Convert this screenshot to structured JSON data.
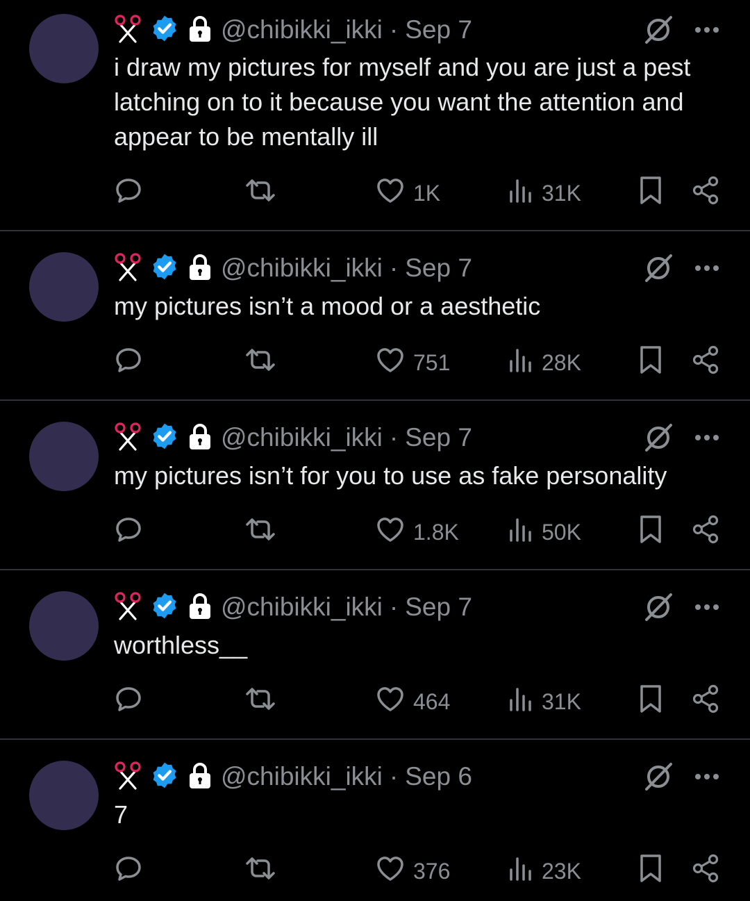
{
  "colors": {
    "background": "#000000",
    "text": "#e7e9ea",
    "muted": "#8b8f94",
    "divider": "#2f3336",
    "verified": "#1d9bf0",
    "avatar": "#332e4f"
  },
  "icons": [
    "scissors-icon",
    "verified-badge-icon",
    "lock-icon",
    "grok-icon",
    "more-icon",
    "reply-icon",
    "retweet-icon",
    "like-icon",
    "views-icon",
    "bookmark-icon",
    "share-icon"
  ],
  "tweets": [
    {
      "handle": "@chibikki_ikki",
      "separator": "·",
      "date": "Sep 7",
      "text": "i draw my pictures for myself and you are just a pest latching on to it because you want the attention and appear to be mentally ill",
      "likes": "1K",
      "views": "31K"
    },
    {
      "handle": "@chibikki_ikki",
      "separator": "·",
      "date": "Sep 7",
      "text": "my pictures isn’t a mood or a aesthetic",
      "likes": "751",
      "views": "28K"
    },
    {
      "handle": "@chibikki_ikki",
      "separator": "·",
      "date": "Sep 7",
      "text": "my pictures isn’t for you to use as fake personality",
      "likes": "1.8K",
      "views": "50K"
    },
    {
      "handle": "@chibikki_ikki",
      "separator": "·",
      "date": "Sep 7",
      "text": "worthless__",
      "likes": "464",
      "views": "31K"
    },
    {
      "handle": "@chibikki_ikki",
      "separator": "·",
      "date": "Sep 6",
      "text": "7",
      "likes": "376",
      "views": "23K"
    }
  ]
}
